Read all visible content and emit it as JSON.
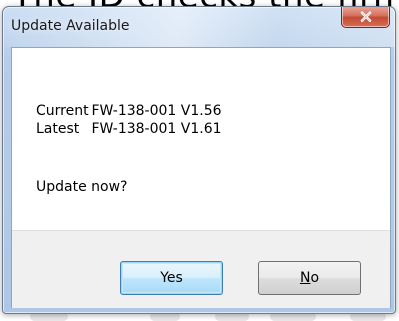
{
  "background": {
    "doc_text": "The ID   checks the firmw"
  },
  "dialog": {
    "title": "Update Available",
    "close_glyph": "X",
    "info": [
      {
        "label": "Current",
        "value": "FW-138-001 V1.56"
      },
      {
        "label": "Latest",
        "value": "FW-138-001 V1.61"
      }
    ],
    "question": "Update now?",
    "buttons": {
      "yes_label": "Yes",
      "no_mnemonic": "N",
      "no_rest": "o"
    }
  },
  "colors": {
    "title_bar": "#b5cde9",
    "close_button": "#c24a34",
    "default_button_border": "#3c7fb1",
    "button_strip": "#f0f0f0"
  },
  "icons": {
    "close": "close-icon"
  }
}
